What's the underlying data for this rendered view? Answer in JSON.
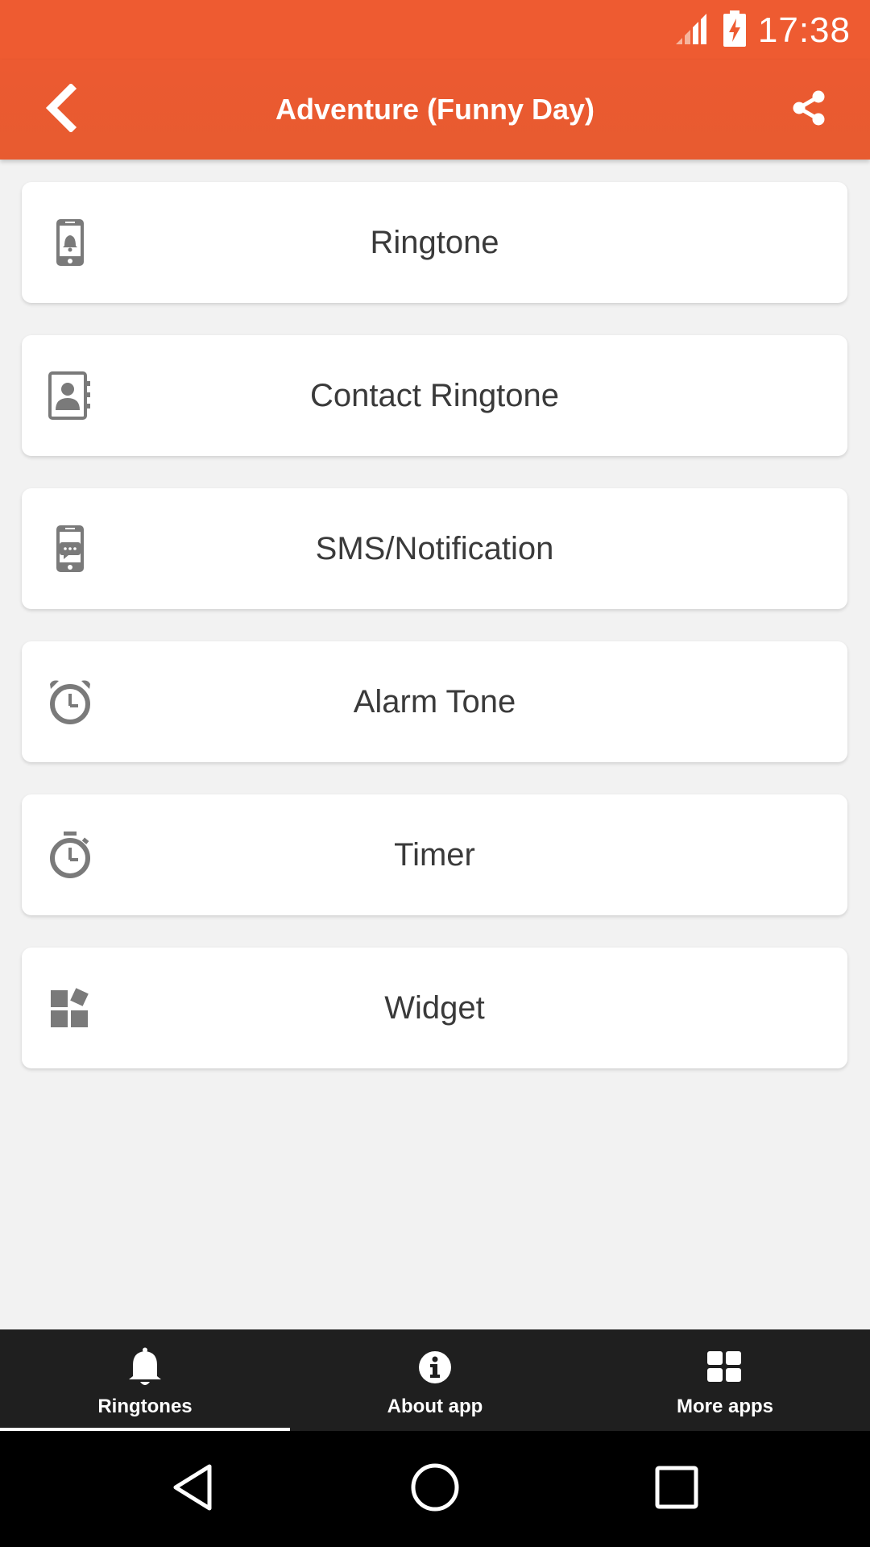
{
  "status_bar": {
    "time": "17:38",
    "icons": [
      "signal-icon",
      "battery-charging-icon"
    ]
  },
  "app_bar": {
    "title": "Adventure (Funny Day)",
    "back_icon": "chevron-left-icon",
    "share_icon": "share-icon"
  },
  "menu": {
    "items": [
      {
        "label": "Ringtone",
        "icon": "phone-bell-icon"
      },
      {
        "label": "Contact Ringtone",
        "icon": "contact-book-icon"
      },
      {
        "label": "SMS/Notification",
        "icon": "phone-message-icon"
      },
      {
        "label": "Alarm Tone",
        "icon": "alarm-clock-icon"
      },
      {
        "label": "Timer",
        "icon": "stopwatch-icon"
      },
      {
        "label": "Widget",
        "icon": "widget-icon"
      }
    ]
  },
  "bottom_nav": {
    "items": [
      {
        "label": "Ringtones",
        "icon": "bell-icon",
        "selected": true
      },
      {
        "label": "About app",
        "icon": "info-icon",
        "selected": false
      },
      {
        "label": "More apps",
        "icon": "grid-icon",
        "selected": false
      }
    ]
  },
  "system_nav": {
    "icons": [
      "back-triangle-icon",
      "home-circle-icon",
      "recents-square-icon"
    ]
  },
  "colors": {
    "accent": "#ee5b31",
    "background": "#f2f2f2",
    "card": "#ffffff",
    "card_text": "#3a3a3a",
    "icon_gray": "#7a7a7a",
    "bottom_nav": "#1f1f1f"
  }
}
